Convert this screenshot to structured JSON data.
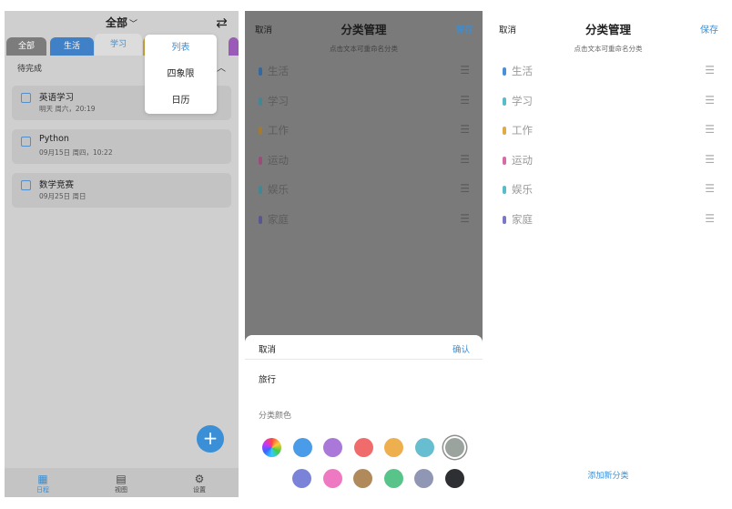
{
  "panel1": {
    "header": {
      "title": "全部",
      "chevron_icon": "chevron-down-icon",
      "swap_icon": "swap-icon"
    },
    "tabs": [
      "全部",
      "生活",
      "学习"
    ],
    "section": {
      "label": "待完成",
      "caret_icon": "caret-up-icon"
    },
    "tasks": [
      {
        "name": "英语学习",
        "date": "明天 周六，20:19"
      },
      {
        "name": "Python",
        "date": "09月15日 周四，10:22"
      },
      {
        "name": "数学竞赛",
        "date": "09月25日 周日"
      }
    ],
    "dropdown": [
      "列表",
      "四象限",
      "日历"
    ],
    "fab": {
      "label": "+"
    },
    "nav": [
      {
        "label": "日程",
        "icon": "list-icon"
      },
      {
        "label": "视图",
        "icon": "calendar-icon"
      },
      {
        "label": "设置",
        "icon": "gear-icon"
      }
    ]
  },
  "category_manager": {
    "cancel": "取消",
    "title": "分类管理",
    "save": "保存",
    "hint": "点击文本可重命名分类",
    "categories": [
      {
        "name": "生活",
        "color": "#4a90d9"
      },
      {
        "name": "学习",
        "color": "#5bbcc9"
      },
      {
        "name": "工作",
        "color": "#e0aa4a"
      },
      {
        "name": "运动",
        "color": "#d56ca8"
      },
      {
        "name": "娱乐",
        "color": "#5bbcc9"
      },
      {
        "name": "家庭",
        "color": "#7b78c9"
      }
    ],
    "add_category": "添加新分类"
  },
  "sheet": {
    "cancel": "取消",
    "confirm": "确认",
    "name_value": "旅行",
    "color_label": "分类颜色",
    "colors_row1": [
      "rainbow",
      "#4a9be8",
      "#a978d8",
      "#f06b6b",
      "#eeb04f",
      "#67bed0",
      "#9aa39e"
    ],
    "colors_row2": [
      "#7b83d9",
      "#ef78c2",
      "#b08a5a",
      "#59c48a",
      "#8f97b5",
      "#2d2f33"
    ],
    "selected_color": "#9aa39e"
  }
}
